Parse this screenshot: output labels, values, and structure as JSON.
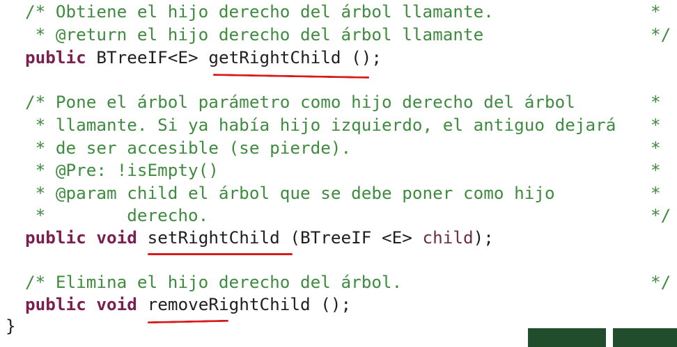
{
  "code_lines": [
    "  /* Obtiene el hijo derecho del árbol llamante.        *",
    "   * @return el hijo derecho del árbol llamante          */",
    "  public BTreeIF<E> getRightChild ();",
    "",
    "  /* Pone el árbol parámetro como hijo derecho del árbol      *",
    "   * llamante. Si ya había hijo izquierdo, el antiguo dejará *",
    "   * de ser accesible (se pierde).                      *",
    "   * @Pre: !isEmpty()                                  *",
    "   * @param child el árbol que se debe poner como hijo       *",
    "   *        derecho.                                     */",
    "  public void setRightChild (BTreeIF <E> child);",
    "",
    "  /* Elimina el hijo derecho del árbol.                   */",
    "  public void removeRightChild ();",
    "}"
  ],
  "lines": {
    "l1": "/* Obtiene el hijo derecho del árbol llamante.",
    "l1_end": "*",
    "l2": " * @return el hijo derecho del árbol llamante",
    "l2_end": "*/",
    "l3_kw": "public",
    "l3_type": " BTreeIF<E> ",
    "l3_name": "getRightChild",
    "l3_rest": " ();",
    "l4": "/* Pone el árbol parámetro como hijo derecho del árbol",
    "l4_end": "*",
    "l5": " * llamante. Si ya había hijo izquierdo, el antiguo dejará",
    "l5_end": "*",
    "l6": " * de ser accesible (se pierde).",
    "l6_end": "*",
    "l7": " * @Pre: !isEmpty()",
    "l7_end": "*",
    "l8": " * @param child el árbol que se debe poner como hijo",
    "l8_end": "*",
    "l9": " *        derecho.",
    "l9_end": "*/",
    "l10_kw": "public void",
    "l10_sp": " ",
    "l10_name": "setRightChild",
    "l10_rest1": " (BTreeIF <E> ",
    "l10_param": "child",
    "l10_rest2": ");",
    "l11": "/* Elimina el hijo derecho del árbol.",
    "l11_end": "*/",
    "l12_kw": "public void",
    "l12_sp": " ",
    "l12_name": "removeRightChild",
    "l12_rest": " ();",
    "l13": "}"
  },
  "colors": {
    "comment": "#3f8b3f",
    "keyword": "#7a1f4f",
    "text": "#1f1f1f",
    "underline": "#d91a1a",
    "nav_button": "#214d2d"
  }
}
